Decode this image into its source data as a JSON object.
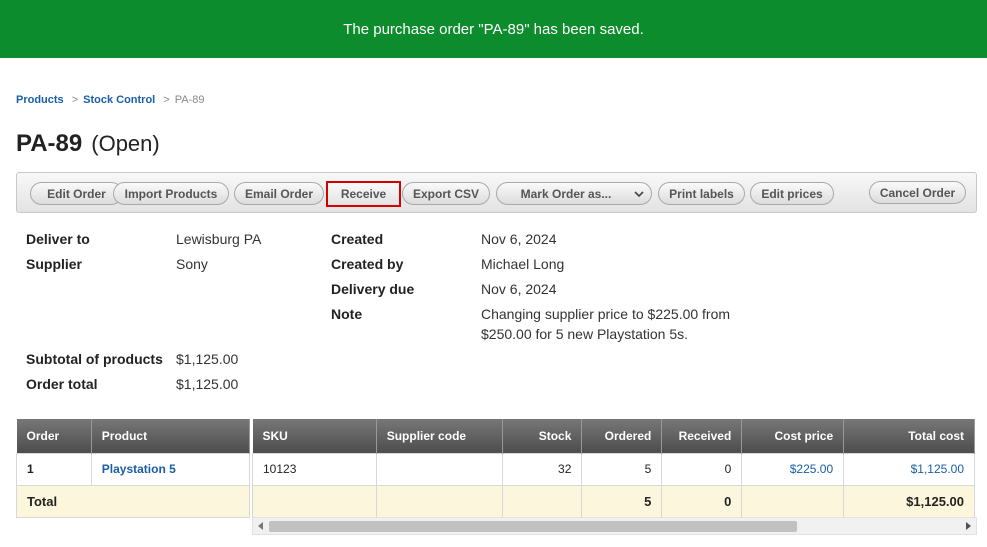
{
  "banner": {
    "message": "The purchase order \"PA-89\" has been saved."
  },
  "breadcrumb": {
    "items": [
      "Products",
      "Stock Control"
    ],
    "separator": ">",
    "current": "PA-89"
  },
  "header": {
    "code": "PA-89",
    "status": "(Open)"
  },
  "toolbar": {
    "edit_order": "Edit Order",
    "import_products": "Import Products",
    "email_order": "Email Order",
    "receive": "Receive",
    "export_csv": "Export CSV",
    "mark_order_as": "Mark Order as...",
    "print_labels": "Print labels",
    "edit_prices": "Edit prices",
    "cancel_order": "Cancel Order"
  },
  "details": {
    "deliver_to_label": "Deliver to",
    "deliver_to": "Lewisburg PA",
    "supplier_label": "Supplier",
    "supplier": "Sony",
    "created_label": "Created",
    "created": "Nov 6, 2024",
    "created_by_label": "Created by",
    "created_by": "Michael Long",
    "delivery_due_label": "Delivery due",
    "delivery_due": "Nov 6, 2024",
    "note_label": "Note",
    "note": "Changing supplier price to $225.00 from $250.00 for 5 new Playstation 5s.",
    "subtotal_label": "Subtotal of products",
    "subtotal": "$1,125.00",
    "order_total_label": "Order total",
    "order_total": "$1,125.00"
  },
  "table": {
    "left_headers": [
      "Order",
      "Product"
    ],
    "right_headers": [
      "SKU",
      "Supplier code",
      "Stock",
      "Ordered",
      "Received",
      "Cost price",
      "Total cost"
    ],
    "row": {
      "order": "1",
      "product": "Playstation 5",
      "sku": "10123",
      "supplier_code": "",
      "stock": "32",
      "ordered": "5",
      "received": "0",
      "cost_price": "$225.00",
      "total_cost": "$1,125.00"
    },
    "total": {
      "label": "Total",
      "ordered": "5",
      "received": "0",
      "total_cost": "$1,125.00"
    }
  },
  "colors": {
    "banner": "#0d8c2e",
    "link": "#1a5ea8",
    "highlight": "#d60000",
    "total_row": "#fbf6dc"
  }
}
